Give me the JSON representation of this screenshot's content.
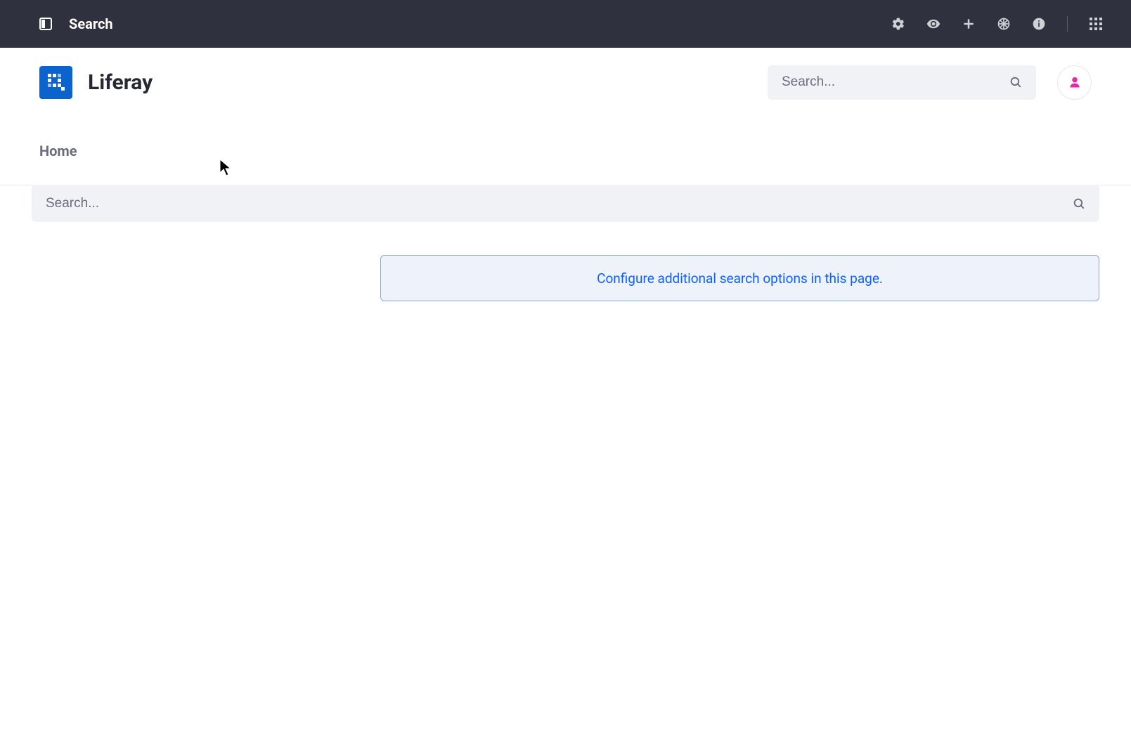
{
  "admin_bar": {
    "title": "Search",
    "icons": {
      "panel_toggle": "panel-toggle",
      "gear": "gear",
      "eye": "eye",
      "plus": "plus",
      "simulate": "simulate",
      "info": "info",
      "grid": "grid"
    }
  },
  "site_header": {
    "site_name": "Liferay",
    "search_placeholder": "Search..."
  },
  "nav": {
    "home_label": "Home"
  },
  "main": {
    "search_placeholder": "Search...",
    "alert_link_text": "Configure additional search options in this page."
  },
  "colors": {
    "admin_bg": "#30313f",
    "brand_blue": "#0b63ce",
    "link_blue": "#0b5fff",
    "alert_bg": "#eef2fa",
    "alert_border": "#89a7e0",
    "avatar_pink": "#e829a5"
  }
}
